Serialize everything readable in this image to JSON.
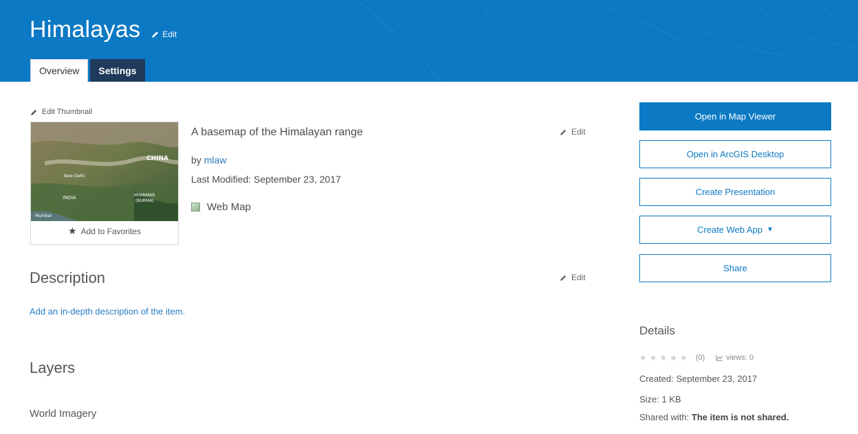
{
  "header": {
    "title": "Himalayas",
    "edit_label": "Edit",
    "tabs": [
      {
        "label": "Overview"
      },
      {
        "label": "Settings"
      }
    ]
  },
  "thumbnail": {
    "edit_label": "Edit Thumbnail",
    "map_labels": [
      "CHINA",
      "New Delhi",
      "INDIA",
      "MYANMAR",
      "(BURMA)",
      "Mumbai"
    ],
    "favorites_label": "Add to Favorites"
  },
  "summary": {
    "text": "A basemap of the Himalayan range",
    "edit_label": "Edit",
    "by_prefix": "by",
    "owner": "mlaw",
    "last_modified": "Last Modified: September 23, 2017",
    "item_type": "Web Map"
  },
  "description": {
    "heading": "Description",
    "edit_label": "Edit",
    "placeholder_link": "Add an in-depth description of the item."
  },
  "layers": {
    "heading": "Layers",
    "items": [
      "World Imagery"
    ]
  },
  "actions": {
    "open_map_viewer": "Open in Map Viewer",
    "open_desktop": "Open in ArcGIS Desktop",
    "create_presentation": "Create Presentation",
    "create_web_app": "Create Web App",
    "share": "Share"
  },
  "details": {
    "title": "Details",
    "rating_count": "(0)",
    "rating_stars": 0,
    "views": "views: 0",
    "created": "Created: September 23, 2017",
    "size": "Size: 1 KB",
    "shared_prefix": "Shared with:",
    "shared_value": "The item is not shared."
  },
  "colors": {
    "accent": "#0b79c4",
    "tab_dark": "#1f3a5a",
    "link": "#2a7cc2"
  }
}
